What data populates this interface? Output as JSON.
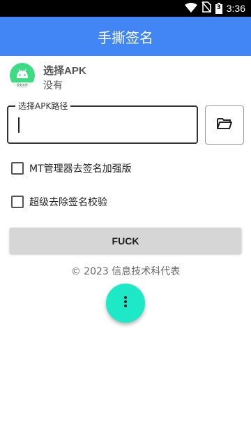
{
  "status_bar": {
    "time": "3:36",
    "battery_level": "3"
  },
  "app_bar": {
    "title": "手撕签名"
  },
  "apk": {
    "title": "选择APK",
    "subtitle": "没有",
    "icon_caption": "没有文件"
  },
  "path_field": {
    "label": "选择APK路径",
    "value": ""
  },
  "options": [
    {
      "label": "MT管理器去签名加强版",
      "checked": false
    },
    {
      "label": "超级去除签名校验",
      "checked": false
    }
  ],
  "action_button": {
    "label": "FUCK"
  },
  "footer": {
    "copyright": "© 2023 信息技术科代表"
  },
  "colors": {
    "app_bar": "#4285f4",
    "fab": "#1de9c6",
    "android_green": "#3ddc84"
  }
}
